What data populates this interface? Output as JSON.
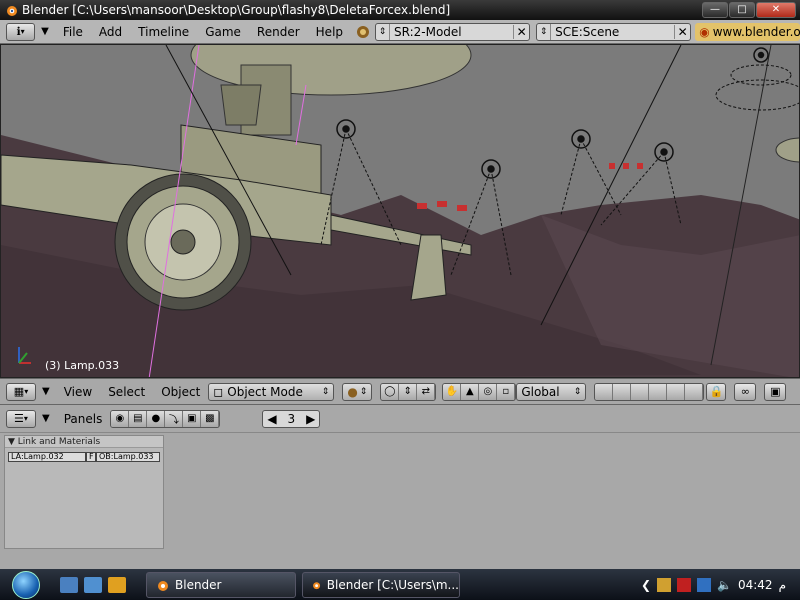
{
  "window": {
    "title": "Blender [C:\\Users\\mansoor\\Desktop\\Group\\flashy8\\DeletaForcex.blend]"
  },
  "infobar": {
    "menus": [
      "File",
      "Add",
      "Timeline",
      "Game",
      "Render",
      "Help"
    ],
    "screen": "SR:2-Model",
    "scene": "SCE:Scene",
    "url": "www.blender.or"
  },
  "viewport": {
    "object_label": "(3) Lamp.033"
  },
  "view_header": {
    "menus": [
      "View",
      "Select",
      "Object"
    ],
    "mode": "Object Mode",
    "orientation": "Global"
  },
  "buttons_window": {
    "panels_label": "Panels",
    "frame": "3",
    "panel": {
      "title": "Link and Materials",
      "lamp": "LA:Lamp.032",
      "f": "F",
      "object": "OB:Lamp.033"
    }
  },
  "taskbar": {
    "tasks": [
      "Blender",
      "Blender [C:\\Users\\m..."
    ],
    "clock": "04:42",
    "ampm": "م"
  },
  "colors": {
    "background": "#7b7b7b",
    "terrain": "#4a3a40",
    "vehicle": "#a5a68c",
    "header": "#b6b6b6",
    "url_bg": "#e3c36a",
    "lamp_pink": "#e070e0"
  }
}
